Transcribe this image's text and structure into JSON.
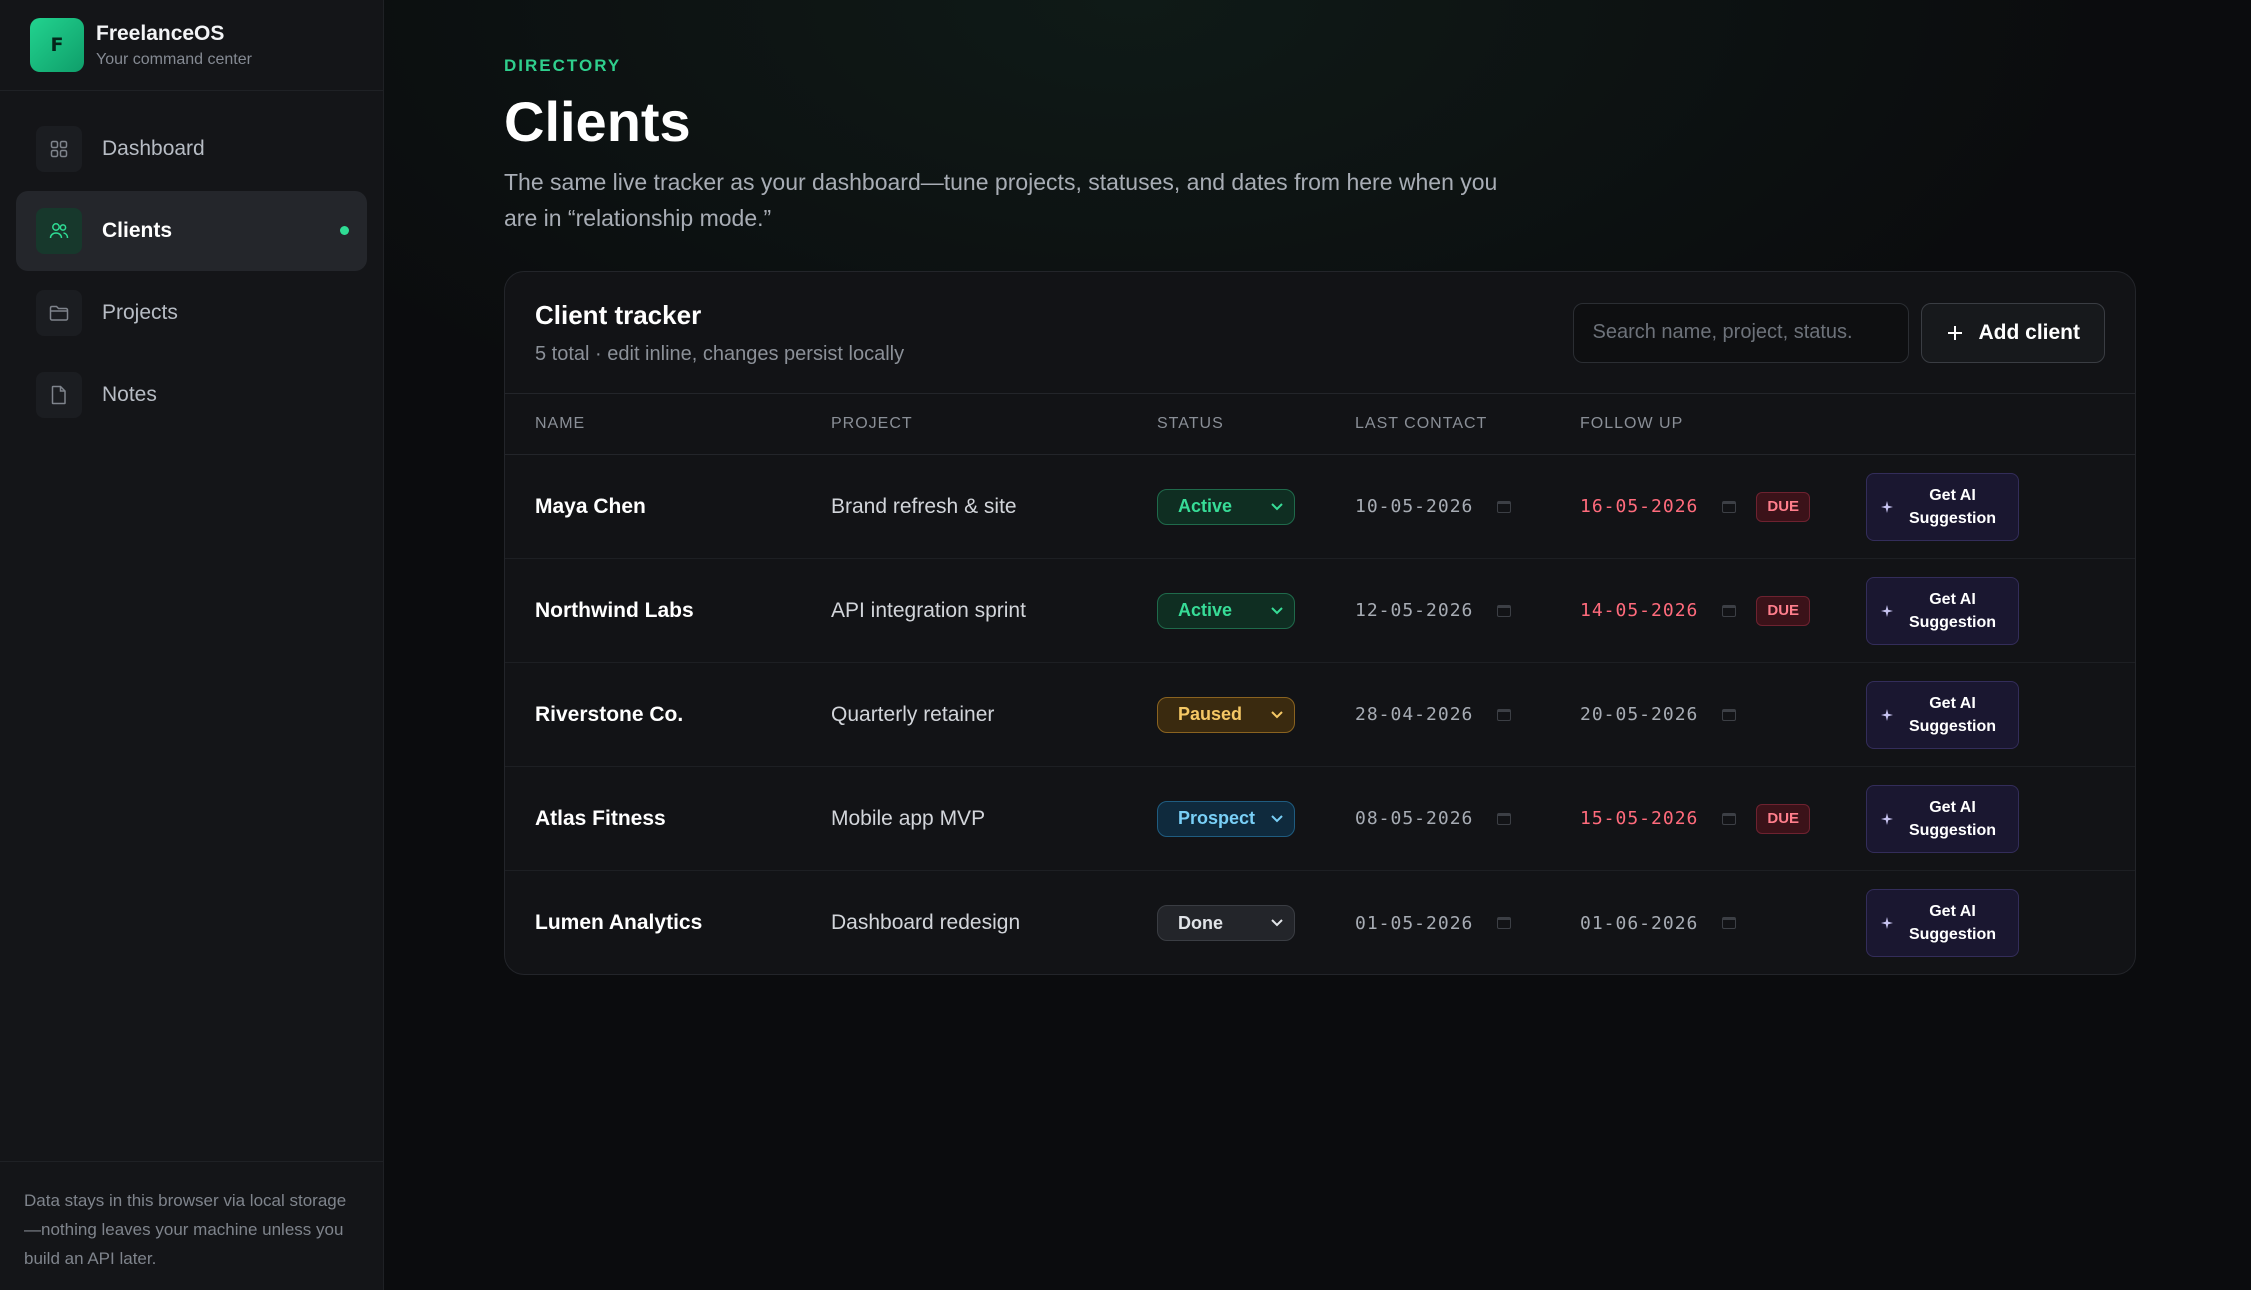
{
  "brand": {
    "logo_letter": "F",
    "name": "FreelanceOS",
    "tagline": "Your command center"
  },
  "sidebar": {
    "items": [
      {
        "label": "Dashboard",
        "icon": "grid-icon"
      },
      {
        "label": "Clients",
        "icon": "users-icon",
        "active": true
      },
      {
        "label": "Projects",
        "icon": "folder-icon"
      },
      {
        "label": "Notes",
        "icon": "file-icon"
      }
    ],
    "footer": "Data stays in this browser via local storage—nothing leaves your machine unless you build an API later."
  },
  "header": {
    "eyebrow": "DIRECTORY",
    "title": "Clients",
    "subtitle": "The same live tracker as your dashboard—tune projects, statuses, and dates from here when you are in “relationship mode.”"
  },
  "tracker": {
    "title": "Client tracker",
    "subtitle": "5 total · edit inline, changes persist locally",
    "search_placeholder": "Search name, project, status.",
    "add_label": "Add client",
    "columns": [
      "NAME",
      "PROJECT",
      "STATUS",
      "LAST CONTACT",
      "FOLLOW UP"
    ],
    "ai_label": "Get AI Suggestion",
    "due_label": "DUE",
    "rows": [
      {
        "name": "Maya Chen",
        "project": "Brand refresh & site",
        "status": "Active",
        "last_contact": "10-05-2026",
        "follow_up": "16-05-2026",
        "due": true
      },
      {
        "name": "Northwind Labs",
        "project": "API integration sprint",
        "status": "Active",
        "last_contact": "12-05-2026",
        "follow_up": "14-05-2026",
        "due": true
      },
      {
        "name": "Riverstone Co.",
        "project": "Quarterly retainer",
        "status": "Paused",
        "last_contact": "28-04-2026",
        "follow_up": "20-05-2026",
        "due": false
      },
      {
        "name": "Atlas Fitness",
        "project": "Mobile app MVP",
        "status": "Prospect",
        "last_contact": "08-05-2026",
        "follow_up": "15-05-2026",
        "due": true
      },
      {
        "name": "Lumen Analytics",
        "project": "Dashboard redesign",
        "status": "Done",
        "last_contact": "01-05-2026",
        "follow_up": "01-06-2026",
        "due": false
      }
    ]
  },
  "colors": {
    "accent": "#2fdc94",
    "due": "#ff6b7c",
    "ai_bg": "#1a1730"
  }
}
